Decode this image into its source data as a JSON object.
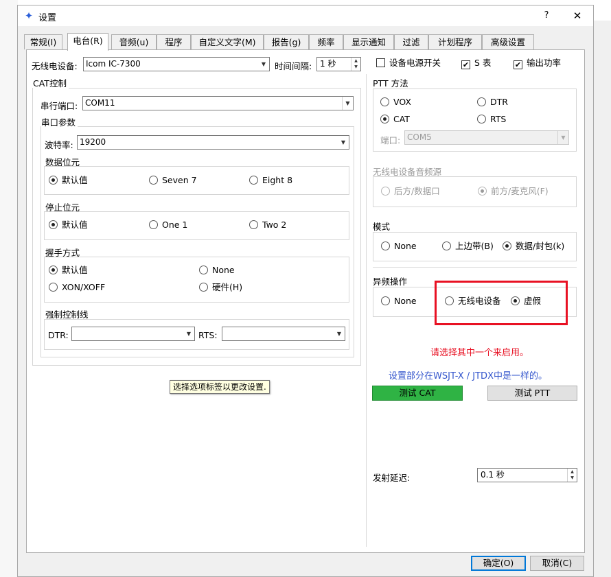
{
  "window": {
    "title": "设置",
    "help": "?",
    "close": "✕"
  },
  "colors": {
    "accent": "#0078d7",
    "green_button": "#2fb344",
    "highlight": "#e81123",
    "warning_text": "#e81123",
    "info_text": "#3355cc"
  },
  "tabs": [
    {
      "label": "常规(I)"
    },
    {
      "label": "电台(R)"
    },
    {
      "label": "音频(u)"
    },
    {
      "label": "程序"
    },
    {
      "label": "自定义文字(M)"
    },
    {
      "label": "报告(g)"
    },
    {
      "label": "频率"
    },
    {
      "label": "显示通知"
    },
    {
      "label": "过滤"
    },
    {
      "label": "计划程序"
    },
    {
      "label": "高级设置"
    }
  ],
  "top": {
    "rig_label": "无线电设备:",
    "rig_value": "Icom IC-7300",
    "interval_label": "时间间隔:",
    "interval_value": "1 秒",
    "power_switch_label": "设备电源开关",
    "power_switch_checked": false,
    "s_meter_label": "S 表",
    "s_meter_checked": true,
    "output_power_label": "输出功率",
    "output_power_checked": true
  },
  "cat": {
    "title": "CAT控制",
    "port_label": "串行端口:",
    "port_value": "COM11",
    "serial_params_title": "串口参数",
    "baud_label": "波特率:",
    "baud_value": "19200",
    "databits": {
      "title": "数据位元",
      "options": [
        "默认值",
        "Seven 7",
        "Eight 8"
      ],
      "selected": 0
    },
    "stopbits": {
      "title": "停止位元",
      "options": [
        "默认值",
        "One 1",
        "Two 2"
      ],
      "selected": 0
    },
    "handshake": {
      "title": "握手方式",
      "options": [
        "默认值",
        "None",
        "XON/XOFF",
        "硬件(H)"
      ],
      "selected": 0
    },
    "force": {
      "title": "强制控制线",
      "dtr_label": "DTR:",
      "dtr_value": "",
      "rts_label": "RTS:",
      "rts_value": ""
    }
  },
  "ptt": {
    "title": "PTT 方法",
    "options": [
      "VOX",
      "DTR",
      "CAT",
      "RTS"
    ],
    "selected": "CAT",
    "port_label": "端口:",
    "port_value": "COM5"
  },
  "audio_source": {
    "title": "无线电设备音频源",
    "options": [
      "后方/数据口",
      "前方/麦克风(F)"
    ],
    "selected": 1
  },
  "mode": {
    "title": "模式",
    "options": [
      "None",
      "上边带(B)",
      "数据/封包(k)"
    ],
    "selected": 2
  },
  "split": {
    "title": "异频操作",
    "options": [
      "None",
      "无线电设备",
      "虚假"
    ],
    "selected": 2
  },
  "messages": {
    "warning": "请选择其中一个来启用。",
    "info": "设置部分在WSJT-X / JTDX中是一样的。"
  },
  "buttons": {
    "test_cat": "测试 CAT",
    "test_ptt": "测试 PTT",
    "ok": "确定(O)",
    "cancel": "取消(C)"
  },
  "tx_delay": {
    "label": "发射延迟:",
    "value": "0.1 秒"
  },
  "tooltip": "选择选项标签以更改设置."
}
